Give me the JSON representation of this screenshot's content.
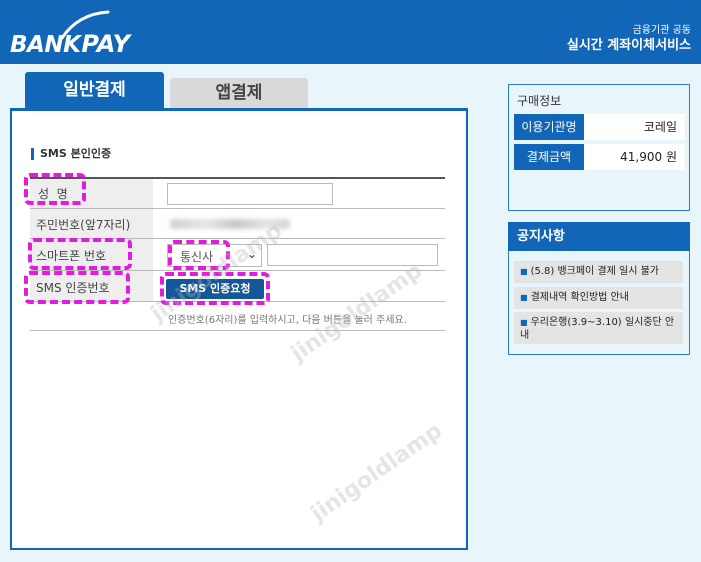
{
  "header": {
    "logo_bank": "BANK",
    "logo_pay": "PAY",
    "sub": "금융기관 공동",
    "title": "실시간 계좌이체서비스"
  },
  "tabs": [
    {
      "label": "일반결제",
      "active": true
    },
    {
      "label": "앱결제",
      "active": false
    }
  ],
  "form": {
    "section_title": "SMS 본인인증",
    "rows": {
      "name": {
        "label": "성  명",
        "value": ""
      },
      "resident": {
        "label": "주민번호(앞7자리)"
      },
      "phone": {
        "label": "스마트폰 번호",
        "carrier_selected": "통신사",
        "number": ""
      },
      "sms": {
        "label": "SMS 인증번호",
        "button": "SMS 인증요청"
      }
    },
    "help_text": "인증번호(6자리)를 입력하시고, 다음 버튼을 눌러 주세요."
  },
  "purchase": {
    "title": "구매정보",
    "org_label": "이용기관명",
    "org_value": "코레일",
    "amount_label": "결제금액",
    "amount_value": "41,900 원"
  },
  "notice": {
    "title": "공지사항",
    "items": [
      "(5.8) 뱅크페이 결제 일시 불가",
      "결제내역 확인방법 안내",
      "우리은행(3.9~3.10) 일시중단 안내"
    ]
  },
  "watermark": "jinigoldlamp",
  "colors": {
    "brand": "#1166b8",
    "highlight": "#e21bdd",
    "panel_bg": "#e8f6fb"
  }
}
